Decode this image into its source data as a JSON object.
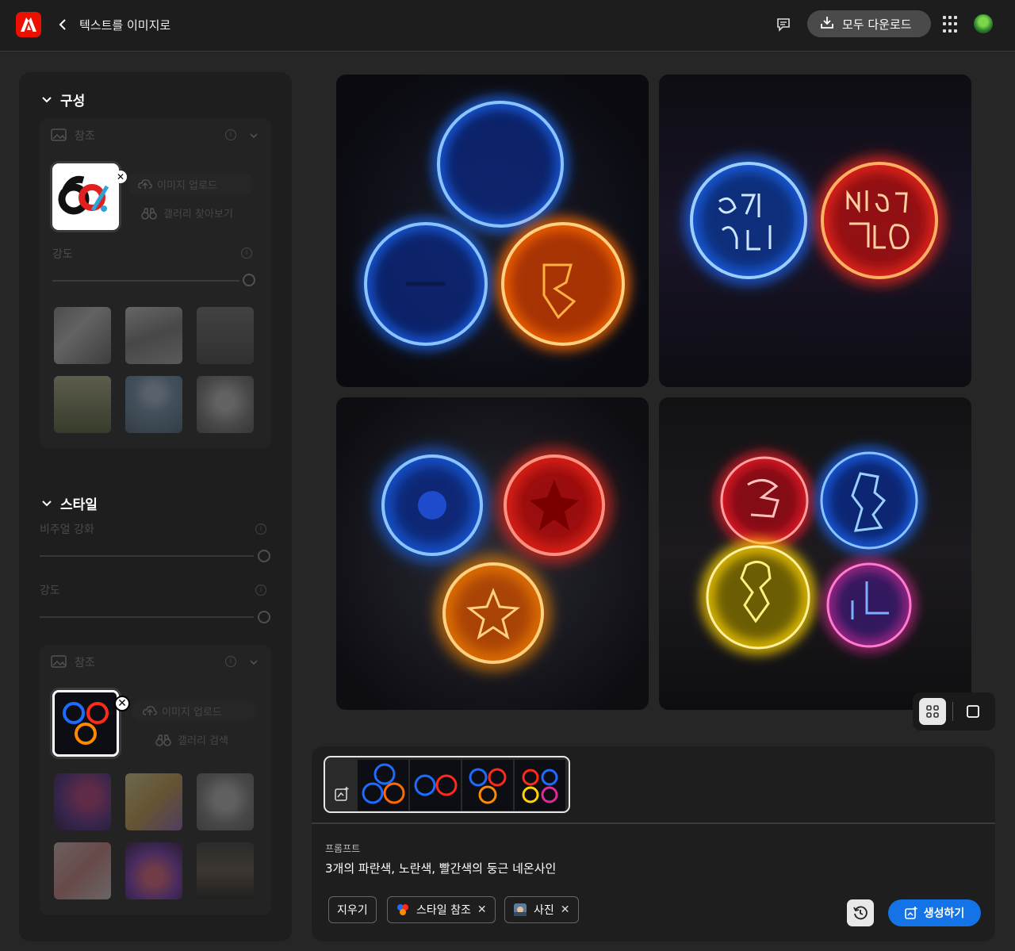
{
  "header": {
    "title": "텍스트를 이미지로",
    "download_all_label": "모두 다운로드",
    "app_logo": "adobe-logo-icon"
  },
  "sidebar": {
    "composition": {
      "heading": "구성",
      "reference_label": "참조",
      "upload_image_label": "이미지 업로드",
      "browse_gallery_label": "갤러리 찾아보기",
      "strength_label": "강도",
      "strength_value": 1.0
    },
    "style": {
      "heading": "스타일",
      "visual_intensity_label": "비주얼 강화",
      "visual_intensity_value": 1.0,
      "strength_label": "강도",
      "strength_value": 1.0,
      "reference_label": "참조",
      "upload_image_label": "이미지 업로드",
      "gallery_search_label": "갤러리 검색"
    }
  },
  "prompt": {
    "label": "프롬프트",
    "text": "3개의 파란색, 노란색, 빨간색의 둥근 네온사인",
    "clear_label": "지우기",
    "chips": [
      {
        "label": "스타일 참조",
        "icon": "style-reference-icon"
      },
      {
        "label": "사진",
        "icon": "photo-icon"
      }
    ],
    "generate_label": "생성하기"
  },
  "colors": {
    "accent_blue": "#1473e6",
    "adobe_red": "#eb1000",
    "neon_blue": "#1e6bff",
    "neon_red": "#ff2a1a",
    "neon_orange": "#ff8a00",
    "neon_yellow": "#ffd400"
  }
}
